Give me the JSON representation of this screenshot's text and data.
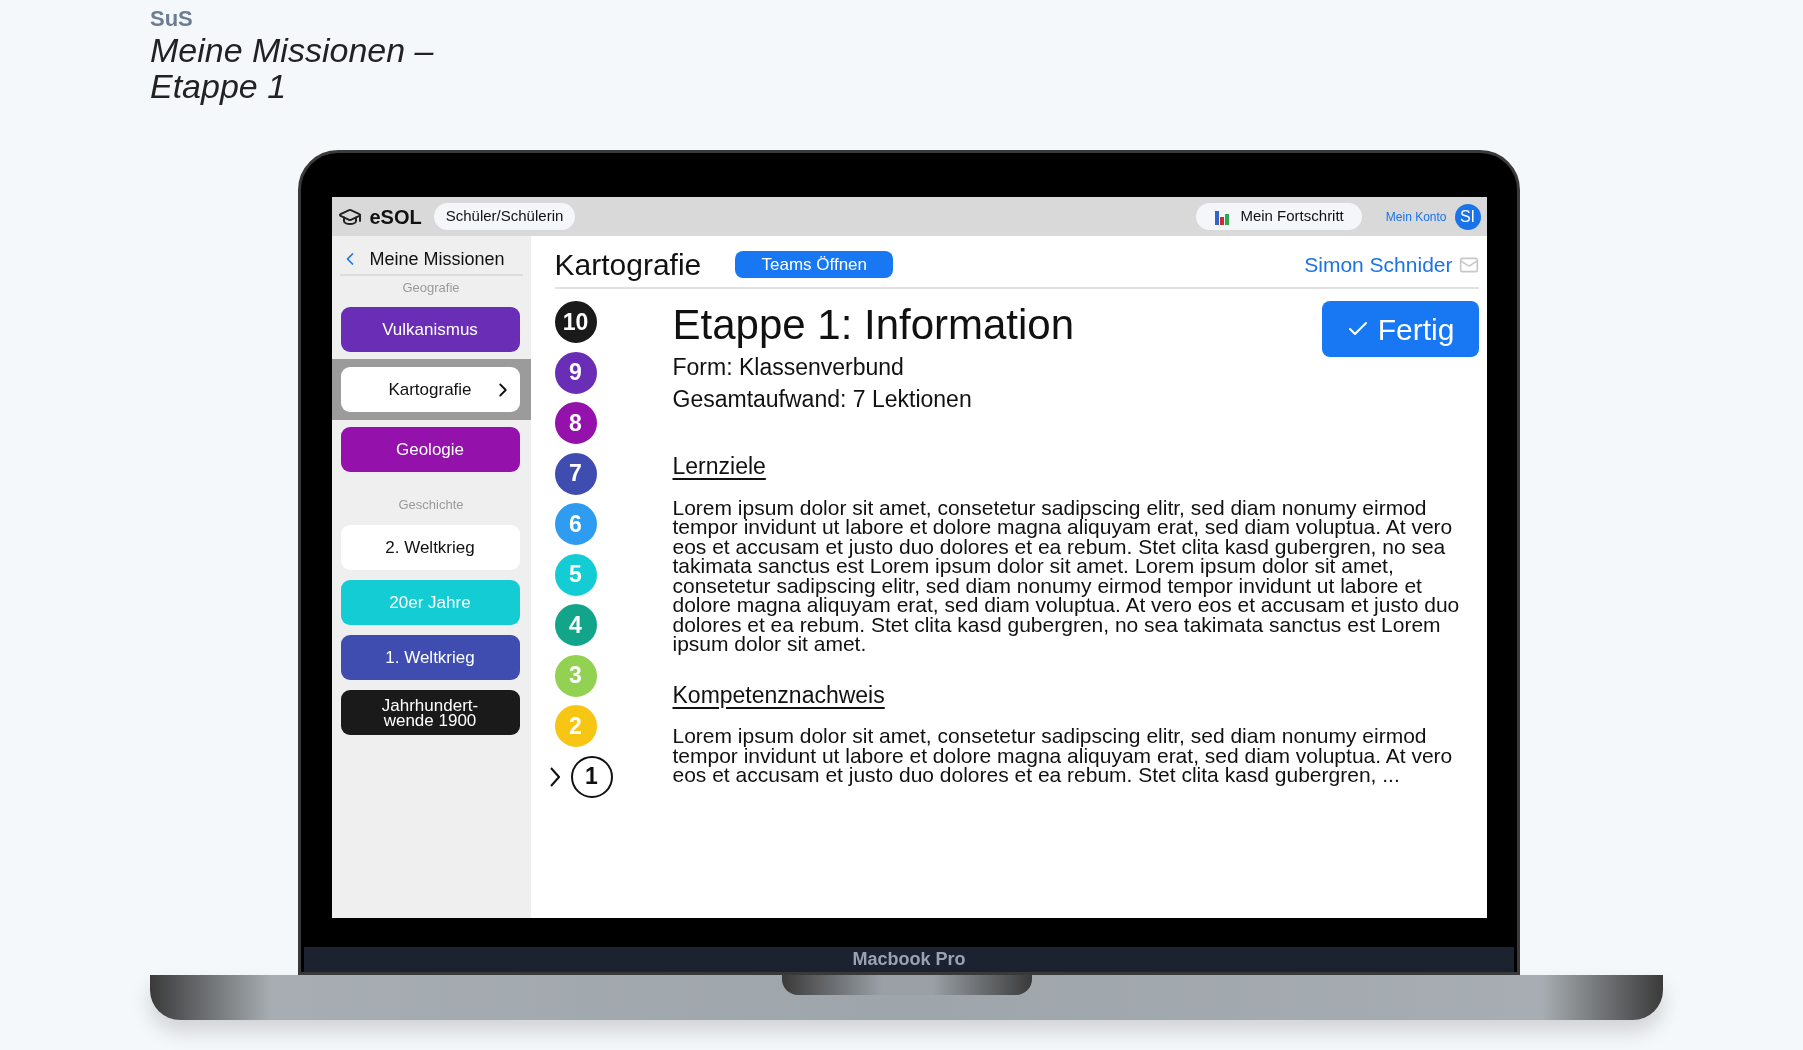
{
  "page": {
    "section": "SuS",
    "title_lines": [
      "Meine Missionen –",
      "Etappe 1"
    ]
  },
  "device": {
    "label": "Macbook Pro"
  },
  "topbar": {
    "app_name": "eSOL",
    "role": "Schüler/Schülerin",
    "progress_button": "Mein Fortschritt",
    "account_link": "Mein Konto",
    "avatar": "SI"
  },
  "sidebar": {
    "back": "Meine Missionen",
    "groups": [
      {
        "heading": "Geografie",
        "items": [
          {
            "label": "Vulkanismus",
            "color": "#6a2db5",
            "selected": false
          },
          {
            "label": "Kartografie",
            "color": "#ffffff",
            "selected": true
          },
          {
            "label": "Geologie",
            "color": "#9412ab",
            "selected": false
          }
        ]
      },
      {
        "heading": "Geschichte",
        "items": [
          {
            "label": "2. Weltkrieg",
            "color": "#ffffff",
            "selected": false
          },
          {
            "label": "20er Jahre",
            "color": "#14ccd4",
            "selected": false
          },
          {
            "label": "1. Weltkrieg",
            "color": "#3f4db1",
            "selected": false
          },
          {
            "label": "Jahrhundert-wende 1900",
            "color": "#1a1a1a",
            "selected": false
          }
        ]
      }
    ]
  },
  "main": {
    "title": "Kartografie",
    "teams_button": "Teams Öffnen",
    "teacher": "Simon Schnider",
    "stages": [
      {
        "label": "10",
        "color": "#1a1a1a",
        "selected": false
      },
      {
        "label": "9",
        "color": "#6a2db5",
        "selected": false
      },
      {
        "label": "8",
        "color": "#9412ab",
        "selected": false
      },
      {
        "label": "7",
        "color": "#3f4db1",
        "selected": false
      },
      {
        "label": "6",
        "color": "#2e9cf0",
        "selected": false
      },
      {
        "label": "5",
        "color": "#14ccd4",
        "selected": false
      },
      {
        "label": "4",
        "color": "#12a589",
        "selected": false
      },
      {
        "label": "3",
        "color": "#93d152",
        "selected": false
      },
      {
        "label": "2",
        "color": "#f7c514",
        "selected": false
      },
      {
        "label": "1",
        "selected": true
      }
    ],
    "stage_title": "Etappe 1: Information",
    "form": "Form: Klassenverbund",
    "effort": "Gesamtaufwand: 7 Lektionen",
    "done_button": "Fertig",
    "sections": [
      {
        "heading": "Lernziele",
        "text": "Lorem ipsum dolor sit amet, consetetur sadipscing elitr, sed diam nonumy eirmod tempor invidunt ut labore et dolore magna aliquyam erat, sed diam voluptua. At vero eos et accusam et justo duo dolores et ea rebum. Stet clita kasd gubergren, no sea takimata sanctus est Lorem ipsum dolor sit amet. Lorem ipsum dolor sit amet, consetetur sadipscing elitr, sed diam nonumy eirmod tempor invidunt ut labore et dolore magna aliquyam erat, sed diam voluptua. At vero eos et accusam et justo duo dolores et ea rebum. Stet clita kasd gubergren, no sea takimata sanctus est Lorem ipsum dolor sit amet."
      },
      {
        "heading": "Kompetenznachweis",
        "text": "Lorem ipsum dolor sit amet, consetetur sadipscing elitr, sed diam nonumy eirmod tempor invidunt ut labore et dolore magna aliquyam erat, sed diam voluptua. At vero eos et accusam et justo duo dolores et ea rebum. Stet clita kasd gubergren, ..."
      }
    ]
  }
}
